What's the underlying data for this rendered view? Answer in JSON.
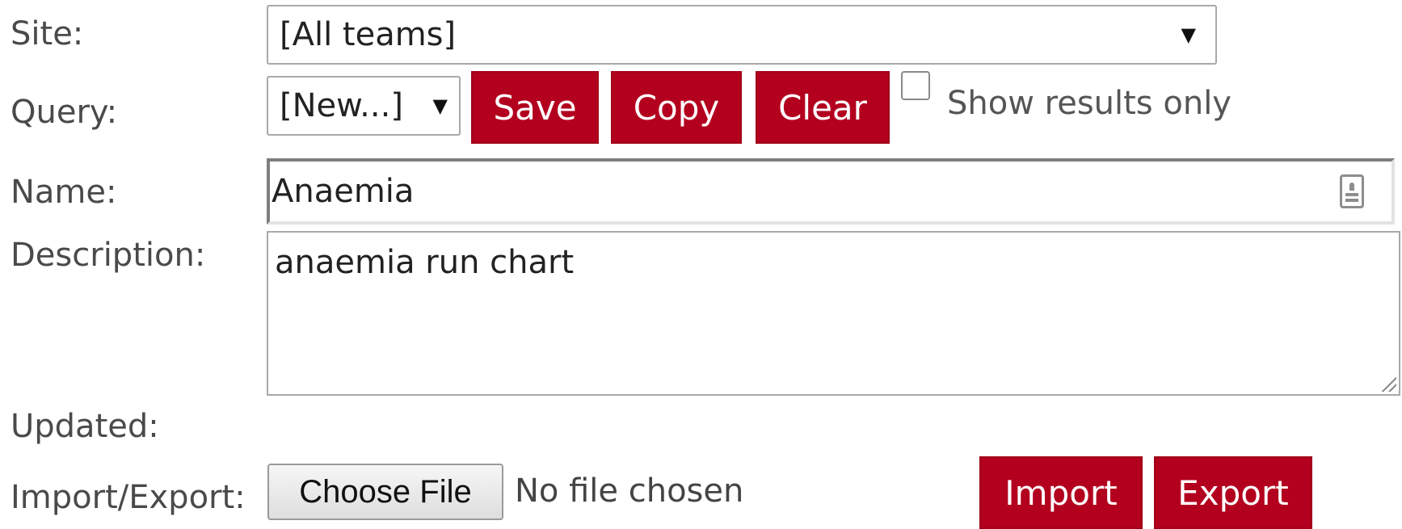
{
  "labels": {
    "site": "Site:",
    "query": "Query:",
    "name": "Name:",
    "description": "Description:",
    "updated": "Updated:",
    "import_export": "Import/Export:"
  },
  "site_select": {
    "value": "[All teams]",
    "arrow": "▼"
  },
  "query_select": {
    "value": "[New...]",
    "arrow": "▼"
  },
  "query_buttons": {
    "save": "Save",
    "copy": "Copy",
    "clear": "Clear"
  },
  "show_results_only": {
    "label": "Show results only",
    "checked": false
  },
  "name_field": {
    "value": "Anaemia",
    "icon": "contact-card-icon"
  },
  "description_field": {
    "value": "anaemia run chart"
  },
  "updated": {
    "value": ""
  },
  "file_input": {
    "button_label": "Choose File",
    "status": "No file chosen"
  },
  "io_buttons": {
    "import": "Import",
    "export": "Export"
  },
  "colors": {
    "button_red": "#b3001e",
    "label_gray": "#4a4a4a"
  }
}
